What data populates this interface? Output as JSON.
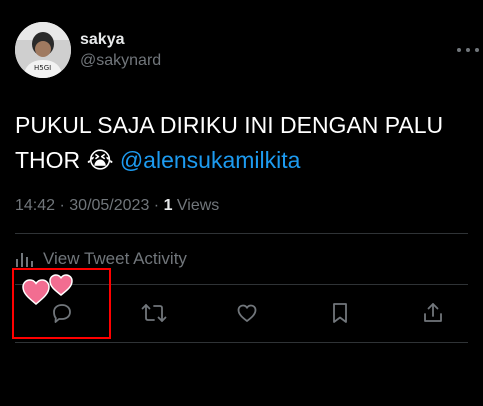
{
  "author": {
    "name": "sakya",
    "handle": "@sakynard"
  },
  "tweet": {
    "text": "PUKUL SAJA DIRIKU INI DENGAN PALU THOR ",
    "emoji": "😭",
    "mention": "@alensukamilkita"
  },
  "meta": {
    "time": "14:42",
    "date": "30/05/2023",
    "separator": " · ",
    "views_count": "1",
    "views_label": " Views"
  },
  "activity": {
    "label": "View Tweet Activity"
  },
  "actions": [
    "reply-icon",
    "retweet-icon",
    "like-icon",
    "bookmark-icon",
    "share-icon"
  ],
  "colors": {
    "background": "#000000",
    "text": "#e7e9ea",
    "muted": "#71767b",
    "link": "#1d9bf0",
    "highlight": "#ff0000",
    "heart": "#f26d91"
  }
}
